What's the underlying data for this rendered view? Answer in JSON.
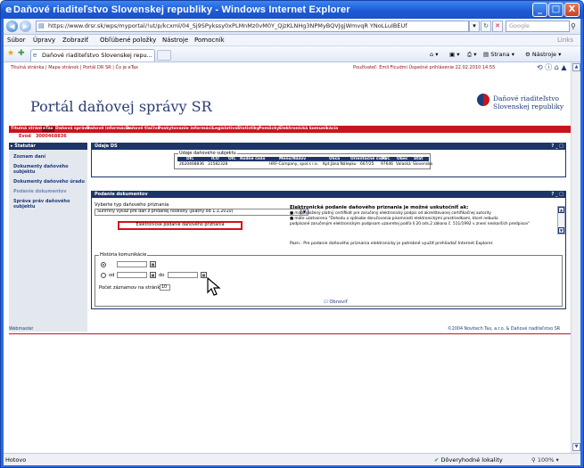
{
  "window": {
    "title": "Daňové riaditeľstvo Slovenskej republiky - Windows Internet Explorer",
    "buttons": {
      "minimize": "_",
      "maximize": "□",
      "close": "X"
    }
  },
  "address_bar": {
    "url": "https://www.drsr.sk/wps/myportal/!ut/p/kcxml/04_Sj9SPykssy0xPLMnMz0vM0Y_QjzKLNHg3NPMyBQVJgjWmvqR YNoLLuIBEUf",
    "search_placeholder": "Google"
  },
  "menu": {
    "items": [
      "Súbor",
      "Úpravy",
      "Zobraziť",
      "Obľúbené položky",
      "Nástroje",
      "Pomocník"
    ],
    "links": "Links"
  },
  "favorites": {
    "tab_title": "Daňové riaditeľstvo Slovenskej repu...",
    "commands": {
      "page": "Strana",
      "tools": "Nástroje"
    }
  },
  "page": {
    "top_links": "Titulná stránka | Mapa stránok | Portál DR SR | Čo je eTax",
    "login_info": "Používateľ: Emil Ficudmi Úspešné prihlásenie 22.02.2010 14:55",
    "portal_title": "Portál daňovej správy SR",
    "logo_line1": "Daňové riaditeľstvo",
    "logo_line2": "Slovenskej republiky",
    "nav": [
      "Titulná stránka",
      "eTax",
      "Daňová správa",
      "Daňové informácie",
      "Daňové tlačivá",
      "Poskytovanie informácií",
      "Legislatíva",
      "Štatistiky",
      "Pomôcky",
      "Elektronická komunikácia"
    ],
    "evod_label": "Evod",
    "evod_number": "3000468836",
    "sidebar": {
      "head": "Štatutár",
      "items": [
        "Zoznam daní",
        "Dokumenty daňového subjektu",
        "Dokumenty daňového úradu",
        "Podanie dokumentov",
        "Správa práv daňového subjektu"
      ]
    },
    "ds_panel": {
      "title": "Údaje DS",
      "controls": "? _ □",
      "fieldset_legend": "Údaje daňového subjektu",
      "columns": [
        "DIČ",
        "IČO",
        "OIČ",
        "Rodné číslo",
        "Meno/Názov",
        "Ulica",
        "Orientačné číslo",
        "PSČ",
        "Obec",
        "Štát"
      ],
      "row": [
        "2620468836",
        "31582328",
        "",
        "",
        "HRF-Company, spol.s r.o.",
        "Kpt.Jána Nálepku",
        "607/25",
        "97646",
        "Valaská",
        "Slovensko"
      ]
    },
    "podanie_panel": {
      "title": "Podanie dokumentov",
      "controls": "? _ □",
      "select_label": "Vyberte typ daňového priznania",
      "select_value": "Súhrnný výkaz pre daň z pridanej hodnoty (platný od 1.1.2010)",
      "submit_button": "Elektronické podanie daňového priznania",
      "info_title": "Elektronická podanie daňového priznania je možné uskutočniť ak:",
      "bullet1": "■ máte uložený platný certifikát pre zaručený elektronický podpis od akreditovanej certifikačnej autority",
      "bullet2": "■ máte uzatvorenú \"Dohodu o spôsobe doručovania písomností elektronickými prostriedkami, ktoré nebudú",
      "bullet3": "podpísané zaručeným elektronickým podpisom uzavretej podľa § 20 ods.2 zákona č. 511/1992 v znení neskorších predpisov\"",
      "note": "Pozn.: Pre podanie daňového priznania elektronicky je potrebné využiť prehliadač Internet Explorer.",
      "history_legend": "História komunikácie",
      "from_label": "od",
      "to_label": "do",
      "page_count_label": "Počet záznamov na stránke",
      "page_count_value": "10",
      "refresh_link": "Obnoviť"
    },
    "footer_left": "Webmaster",
    "footer_right": "©2004 Novitech Tax, a.r.o. & Daňové riaditeľstvo SR"
  },
  "status_bar": {
    "status": "Hotovo",
    "zone": "Dôveryhodné lokality",
    "zoom": "100%"
  }
}
